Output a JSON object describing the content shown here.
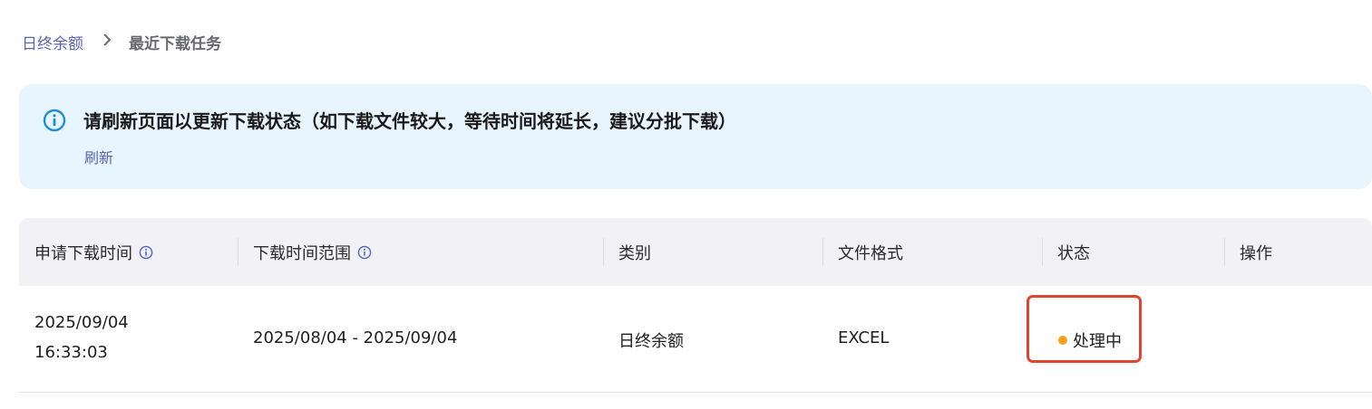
{
  "breadcrumb": {
    "parent": "日终余额",
    "separator": ">",
    "current": "最近下载任务"
  },
  "alert": {
    "icon": "info-circle-icon",
    "title": "请刷新页面以更新下载状态（如下载文件较大，等待时间将延长，建议分批下载）",
    "action": "刷新",
    "colors": {
      "background": "#e8f5fe",
      "icon": "#1c8fd8",
      "link": "#5a64b0"
    }
  },
  "table": {
    "columns": [
      {
        "label": "申请下载时间",
        "has_info": true
      },
      {
        "label": "下载时间范围",
        "has_info": true
      },
      {
        "label": "类别",
        "has_info": false
      },
      {
        "label": "文件格式",
        "has_info": false
      },
      {
        "label": "状态",
        "has_info": false
      },
      {
        "label": "操作",
        "has_info": false
      }
    ],
    "rows": [
      {
        "request_date": "2025/09/04",
        "request_time": "16:33:03",
        "range": "2025/08/04 - 2025/09/04",
        "category": "日终余额",
        "format": "EXCEL",
        "status": "处理中",
        "status_color": "#f5a11b",
        "action": ""
      }
    ]
  },
  "highlight_color": "#e0442f"
}
